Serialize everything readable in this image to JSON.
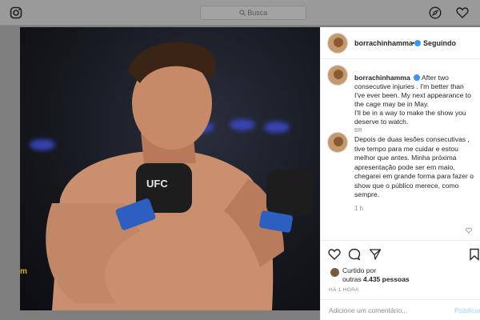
{
  "topbar": {
    "search_placeholder": "Busca",
    "icons": [
      "instagram-icon",
      "search-icon",
      "compass-icon",
      "heart-icon"
    ]
  },
  "photo": {
    "corner_label": "m"
  },
  "post": {
    "username": "borrachinhamma",
    "follow_status": "Seguindo",
    "dot": "•",
    "caption_en": "After two consecutive injuries . I'm better than I've ever been. My next appearance to the cage may be in May.\nI'll be in a way to make the show you deserve to watch.",
    "br_label": "BR",
    "caption_pt": "Depois de duas lesões consecutivas , tive tempo para me cuidar e estou melhor que antes. Minha próxima apresentação pode ser em maio, chegarei em grande forma para fazer o show que o público merece, como sempre.",
    "comment_time": "1 h",
    "liked_by_label": "Curtido por",
    "likes_prefix": "outras ",
    "likes_count": "4.435 pessoas",
    "posted_ago": "HÁ 1 HORA",
    "comment_placeholder": "Adicione um comentário...",
    "publish_label": "Publicar"
  },
  "colors": {
    "verified": "#3897f0",
    "publish": "#b2dffc",
    "overlay": "#7f7f7f"
  }
}
